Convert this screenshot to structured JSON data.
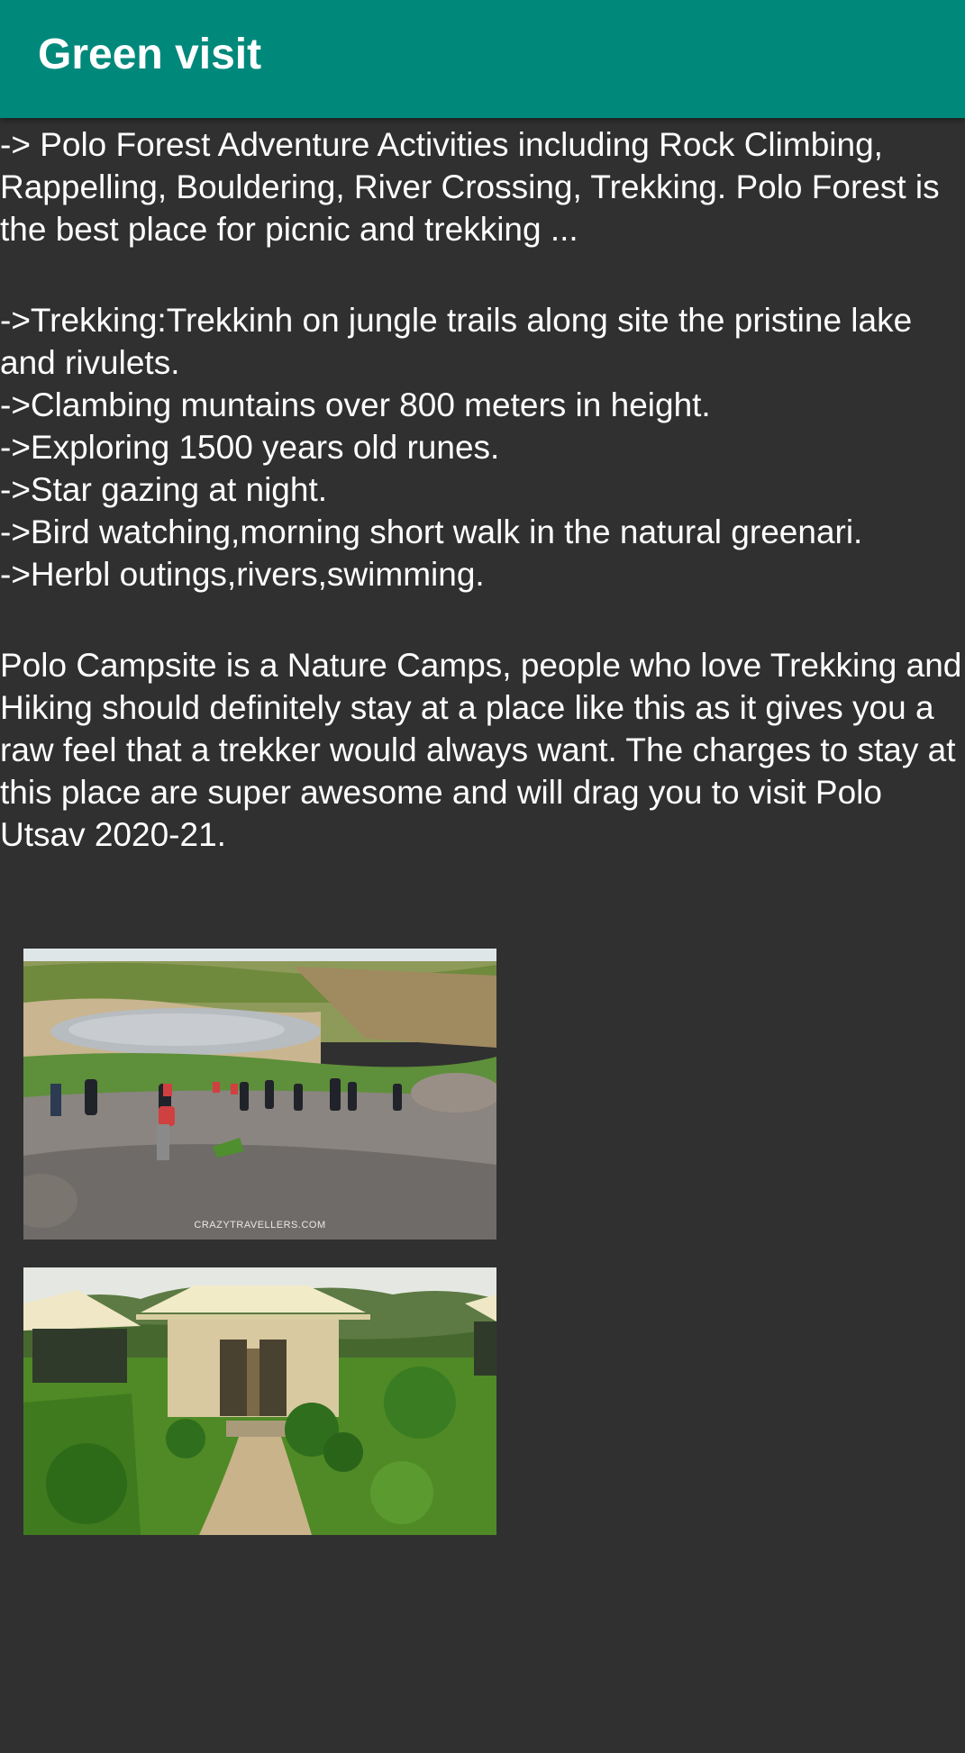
{
  "app_bar": {
    "title": "Green visit",
    "color": "#00897b"
  },
  "content": {
    "intro": "-> Polo Forest Adventure Activities including Rock Climbing, Rappelling, Bouldering, River Crossing, Trekking. Polo Forest is the best place for picnic and trekking ...",
    "activities": [
      "->Trekking:Trekkinh on jungle trails along site the pristine lake and rivulets.",
      "->Clambing muntains over 800 meters in height.",
      "->Exploring 1500 years old runes.",
      "->Star gazing at night.",
      "->Bird watching,morning short walk in the natural greenari.",
      "->Herbl outings,rivers,swimming."
    ],
    "campsite": "Polo Campsite is a Nature Camps, people who love Trekking and Hiking should definitely stay at a place like this as it gives you a raw feel that a trekker would always want. The charges to stay at this place are super awesome and will drag you to visit Polo Utsav 2020-21."
  },
  "images": [
    {
      "name": "trekkers-climbing-rocks-photo",
      "watermark": "CRAZYTRAVELLERS.COM"
    },
    {
      "name": "campsite-tents-photo"
    }
  ],
  "colors": {
    "background": "#303030",
    "text": "#ffffff"
  }
}
